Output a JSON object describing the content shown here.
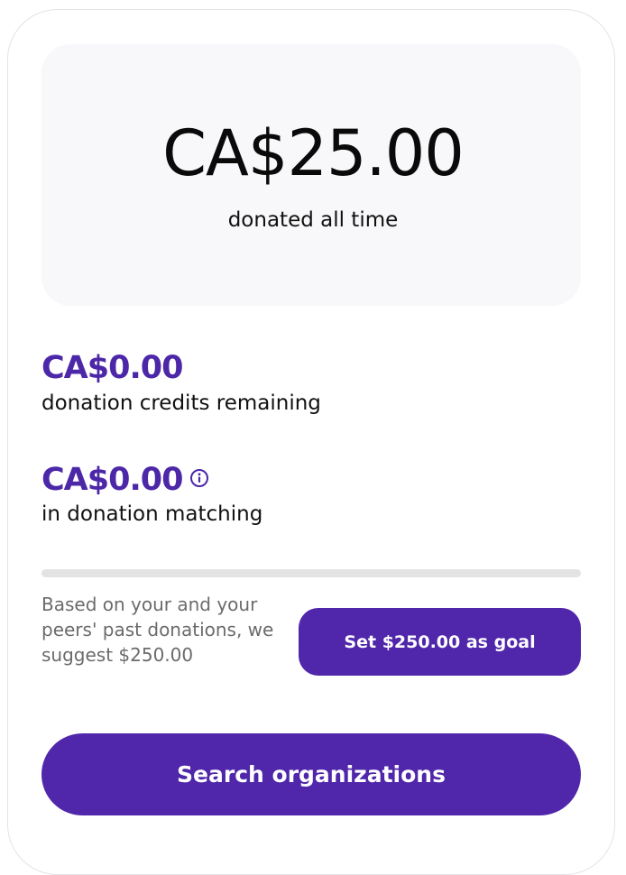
{
  "summary": {
    "total_amount": "CA$25.00",
    "total_label": "donated all time"
  },
  "credits": {
    "amount": "CA$0.00",
    "label": "donation credits remaining"
  },
  "matching": {
    "amount": "CA$0.00",
    "label": "in donation matching",
    "info_icon": "info-circle-icon"
  },
  "goal": {
    "progress_fraction": 0,
    "suggestion_text": "Based on your and your peers' past donations, we suggest $250.00",
    "set_goal_label": "Set $250.00 as goal"
  },
  "actions": {
    "search_label": "Search organizations"
  },
  "colors": {
    "accent": "#5027aa",
    "accent_text": "#4c28a8",
    "track": "#e3e3e3",
    "panel": "#f8f8fa"
  }
}
